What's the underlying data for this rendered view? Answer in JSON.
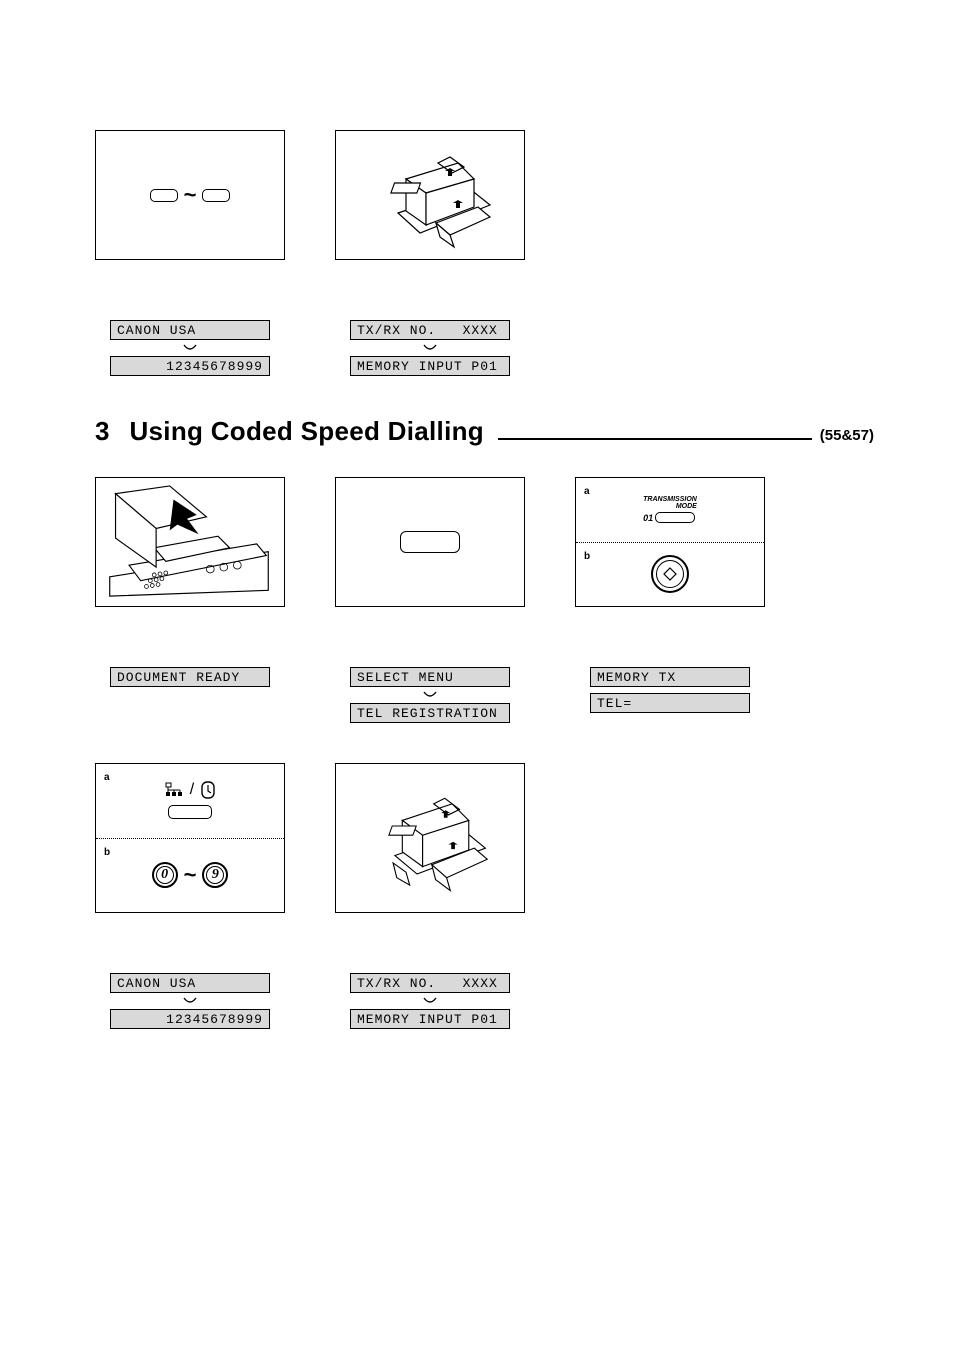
{
  "section2": {
    "row1": {
      "cell1_note": "keycap range icon",
      "display_pair_1": {
        "top": "CANON USA",
        "bottom": "12345678999"
      },
      "display_pair_2": {
        "top": "TX/RX NO.   XXXX",
        "bottom": "MEMORY INPUT P01"
      }
    }
  },
  "heading3": {
    "num": "3",
    "title": "Using Coded Speed Dialling",
    "pageref": "(55&57)"
  },
  "section3": {
    "row1": {
      "transmission_label": "TRANSMISSION\nMODE",
      "tm_code": "01",
      "a": "a",
      "b": "b",
      "display_doc_ready": "DOCUMENT READY",
      "display_menu_top": "SELECT MENU",
      "display_menu_bottom": "TEL REGISTRATION",
      "display_memtx": "MEMORY TX",
      "display_tel": "TEL="
    },
    "row2": {
      "a": "a",
      "b": "b",
      "digit0": "0",
      "digit9": "9",
      "display_pair_1": {
        "top": "CANON USA",
        "bottom": "12345678999"
      },
      "display_pair_2": {
        "top": "TX/RX NO.   XXXX",
        "bottom": "MEMORY INPUT P01"
      }
    }
  }
}
